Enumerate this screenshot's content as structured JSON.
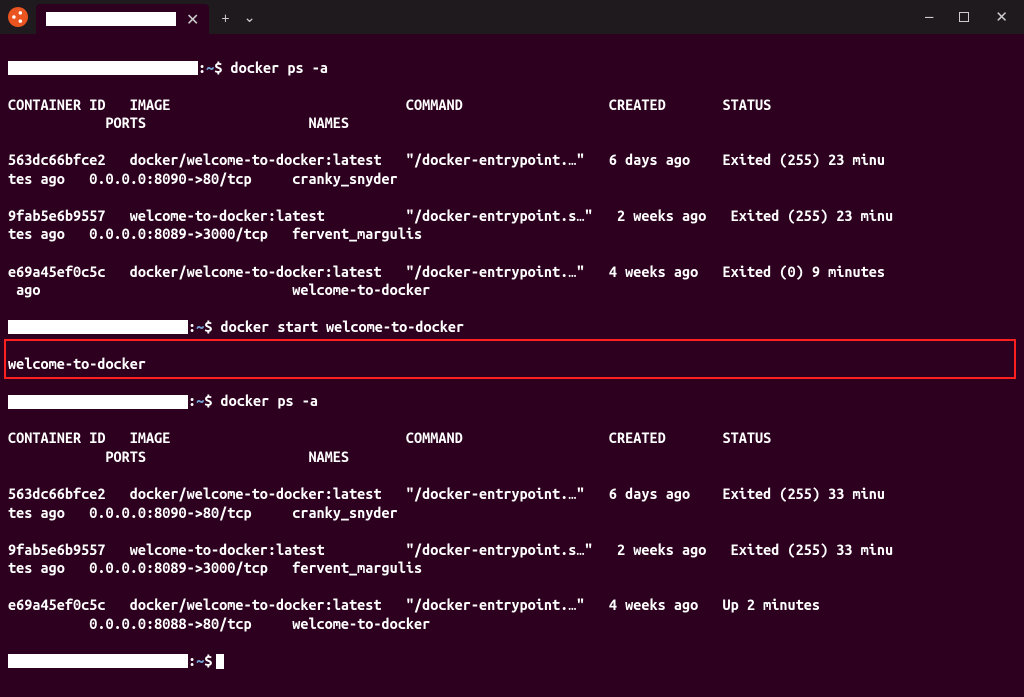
{
  "titlebar": {
    "new_tab_label": "+",
    "tab_menu_label": "⌄",
    "minimize": "—",
    "close": "✕"
  },
  "p1": {
    "cmd": "docker ps -a",
    "header": "CONTAINER ID   IMAGE                             COMMAND                  CREATED       STATUS\n            PORTS                    NAMES",
    "r1": "563dc66bfce2   docker/welcome-to-docker:latest   \"/docker-entrypoint.…\"   6 days ago    Exited (255) 23 minu\ntes ago   0.0.0.0:8090->80/tcp     cranky_snyder",
    "r2": "9fab5e6b9557   welcome-to-docker:latest          \"/docker-entrypoint.s…\"   2 weeks ago   Exited (255) 23 minu\ntes ago   0.0.0.0:8089->3000/tcp   fervent_margulis",
    "r3": "e69a45ef0c5c   docker/welcome-to-docker:latest   \"/docker-entrypoint.…\"   4 weeks ago   Exited (0) 9 minutes\n ago                               welcome-to-docker"
  },
  "p2": {
    "cmd": "docker start welcome-to-docker",
    "out": "welcome-to-docker"
  },
  "p3": {
    "cmd": "docker ps -a",
    "header": "CONTAINER ID   IMAGE                             COMMAND                  CREATED       STATUS\n            PORTS                    NAMES",
    "r1": "563dc66bfce2   docker/welcome-to-docker:latest   \"/docker-entrypoint.…\"   6 days ago    Exited (255) 33 minu\ntes ago   0.0.0.0:8090->80/tcp     cranky_snyder",
    "r2": "9fab5e6b9557   welcome-to-docker:latest          \"/docker-entrypoint.s…\"   2 weeks ago   Exited (255) 33 minu\ntes ago   0.0.0.0:8089->3000/tcp   fervent_margulis",
    "r3": "e69a45ef0c5c   docker/welcome-to-docker:latest   \"/docker-entrypoint.…\"   4 weeks ago   Up 2 minutes\n          0.0.0.0:8088->80/tcp     welcome-to-docker"
  }
}
